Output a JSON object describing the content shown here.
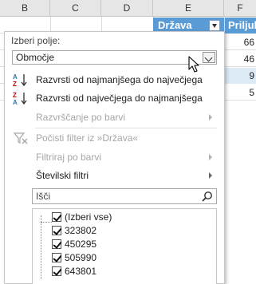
{
  "sheet": {
    "columns": [
      "B",
      "C",
      "D",
      "E",
      "F"
    ],
    "header_cells": {
      "drzava": "Država",
      "prilju": "Priljub"
    },
    "value_column": [
      "66",
      "46",
      "9",
      "5"
    ]
  },
  "filter_menu": {
    "field_label": "Izberi polje:",
    "field_value": "Območje",
    "items": [
      {
        "label": "Razvrsti od najmanjšega do največjega",
        "enabled": true,
        "submenu": false
      },
      {
        "label": "Razvrsti od največjega do najmanjšega",
        "enabled": true,
        "submenu": false
      },
      {
        "label": "Razvrščanje po barvi",
        "enabled": false,
        "submenu": true
      },
      {
        "label": "Počisti filter iz »Država«",
        "enabled": false,
        "submenu": false
      },
      {
        "label": "Filtriraj po barvi",
        "enabled": false,
        "submenu": true
      },
      {
        "label": "Številski filtri",
        "enabled": true,
        "submenu": true
      }
    ],
    "search_placeholder": "Išči",
    "list": [
      {
        "label": "(Izberi vse)",
        "checked": true
      },
      {
        "label": "323802",
        "checked": true
      },
      {
        "label": "450295",
        "checked": true
      },
      {
        "label": "505990",
        "checked": true
      },
      {
        "label": "643801",
        "checked": true
      }
    ]
  },
  "colors": {
    "header_blue": "#5b9bd5",
    "band_blue": "#ddebf7",
    "icon_blue": "#2e75b6",
    "icon_red": "#c00000"
  },
  "icons": {
    "sort_asc": "sort-ascending-icon",
    "sort_desc": "sort-descending-icon",
    "clear_filter": "clear-filter-icon",
    "search": "search-icon",
    "cursor": "mouse-pointer-icon"
  }
}
